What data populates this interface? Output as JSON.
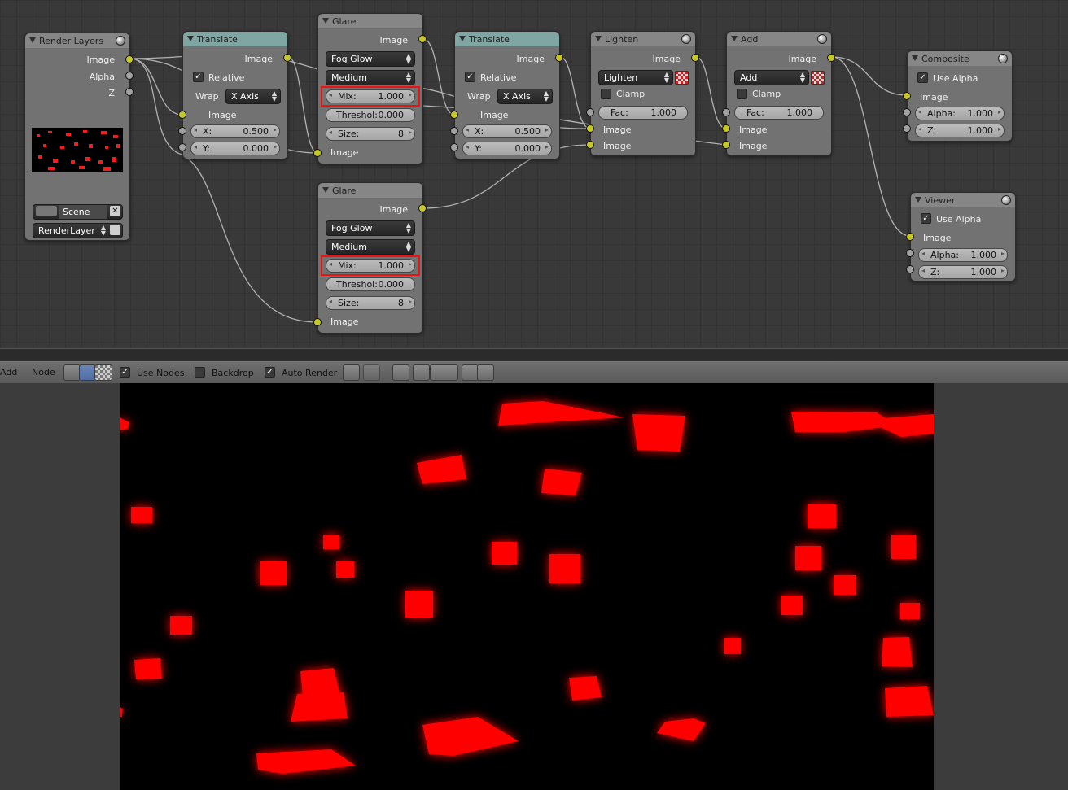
{
  "nodes": {
    "render_layers": {
      "title": "Render Layers",
      "outputs": [
        "Image",
        "Alpha",
        "Z"
      ],
      "scene": "Scene",
      "layer": "RenderLayer"
    },
    "translate1": {
      "title": "Translate",
      "out": "Image",
      "relative": "Relative",
      "wrap_label": "Wrap",
      "wrap": "X Axis",
      "in_image": "Image",
      "x_label": "X:",
      "x": "0.500",
      "y_label": "Y:",
      "y": "0.000"
    },
    "glare1": {
      "title": "Glare",
      "out": "Image",
      "type": "Fog Glow",
      "quality": "Medium",
      "mix_label": "Mix:",
      "mix": "1.000",
      "thresh_label": "Threshol:",
      "thresh": "0.000",
      "size_label": "Size:",
      "size": "8",
      "in_image": "Image"
    },
    "translate2": {
      "title": "Translate",
      "out": "Image",
      "relative": "Relative",
      "wrap_label": "Wrap",
      "wrap": "X Axis",
      "in_image": "Image",
      "x_label": "X:",
      "x": "0.500",
      "y_label": "Y:",
      "y": "0.000"
    },
    "lighten": {
      "title": "Lighten",
      "out": "Image",
      "mode": "Lighten",
      "clamp": "Clamp",
      "fac_label": "Fac:",
      "fac": "1.000",
      "in1": "Image",
      "in2": "Image"
    },
    "add": {
      "title": "Add",
      "out": "Image",
      "mode": "Add",
      "clamp": "Clamp",
      "fac_label": "Fac:",
      "fac": "1.000",
      "in1": "Image",
      "in2": "Image"
    },
    "composite": {
      "title": "Composite",
      "use_alpha": "Use Alpha",
      "in_image": "Image",
      "alpha_label": "Alpha:",
      "alpha": "1.000",
      "z_label": "Z:",
      "z": "1.000"
    },
    "viewer": {
      "title": "Viewer",
      "use_alpha": "Use Alpha",
      "in_image": "Image",
      "alpha_label": "Alpha:",
      "alpha": "1.000",
      "z_label": "Z:",
      "z": "1.000"
    },
    "glare2": {
      "title": "Glare",
      "out": "Image",
      "type": "Fog Glow",
      "quality": "Medium",
      "mix_label": "Mix:",
      "mix": "1.000",
      "thresh_label": "Threshol:",
      "thresh": "0.000",
      "size_label": "Size:",
      "size": "8",
      "in_image": "Image"
    }
  },
  "header": {
    "add": "Add",
    "node": "Node",
    "use_nodes": "Use Nodes",
    "backdrop": "Backdrop",
    "auto_render": "Auto Render"
  },
  "colors": {
    "socket_image": "#c7c729",
    "socket_value": "#a1a1a1",
    "highlight": "#ee1111",
    "render_red": "#ff0000",
    "converter_header": "#7fa6a2"
  }
}
